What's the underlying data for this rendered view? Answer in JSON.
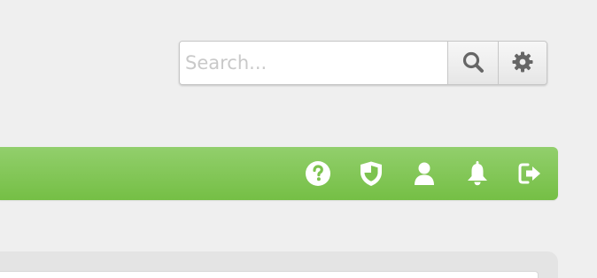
{
  "search": {
    "placeholder": "Search...",
    "value": ""
  },
  "icons": {
    "search_button": "search-icon",
    "settings_button": "gear-icon",
    "toolbar": [
      "help-icon",
      "shield-icon",
      "user-icon",
      "bell-icon",
      "logout-icon"
    ]
  },
  "colors": {
    "toolbar_green": "#7dc34f",
    "button_icon": "#666666",
    "toolbar_icon": "#ffffff",
    "page_background": "#efefef"
  }
}
